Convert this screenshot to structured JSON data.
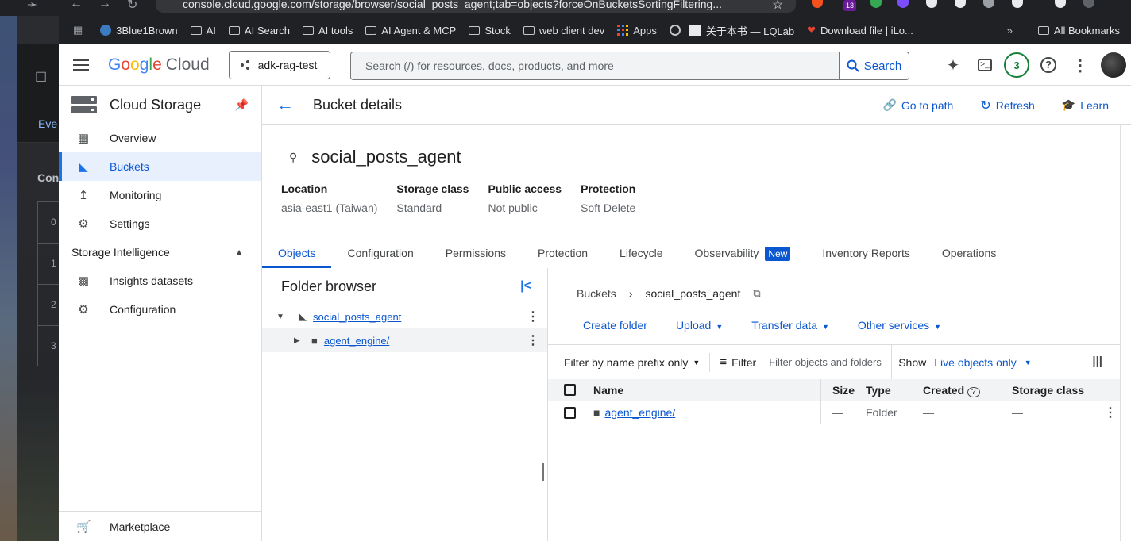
{
  "browser": {
    "url": "console.cloud.google.com/storage/browser/social_posts_agent;tab=objects?forceOnBucketsSortingFiltering...",
    "ext_badge": "13",
    "bookmarks": [
      "3Blue1Brown",
      "AI",
      "AI Search",
      "AI tools",
      "AI Agent & MCP",
      "Stock",
      "web client dev",
      "Apps",
      "关于本书 — LQLab",
      "Download file | iLo..."
    ],
    "more": "»",
    "all_bookmarks": "All Bookmarks"
  },
  "background_window": {
    "eve": "Eve",
    "con": "Con",
    "rows": [
      "0",
      "1",
      "2",
      "3"
    ]
  },
  "header": {
    "logo_google": "Google",
    "logo_cloud": "Cloud",
    "project": "adk-rag-test",
    "search_placeholder": "Search (/) for resources, docs, products, and more",
    "search_button": "Search",
    "notifications_count": "3"
  },
  "leftnav": {
    "title": "Cloud Storage",
    "items": [
      {
        "label": "Overview",
        "icon": "dashboard-icon"
      },
      {
        "label": "Buckets",
        "icon": "bucket-icon",
        "active": true
      },
      {
        "label": "Monitoring",
        "icon": "chart-icon"
      },
      {
        "label": "Settings",
        "icon": "gear-icon"
      }
    ],
    "section": "Storage Intelligence",
    "section_items": [
      {
        "label": "Insights datasets",
        "icon": "dataset-icon"
      },
      {
        "label": "Configuration",
        "icon": "gear-icon"
      }
    ],
    "marketplace": "Marketplace"
  },
  "subheader": {
    "title": "Bucket details",
    "go_to_path": "Go to path",
    "refresh": "Refresh",
    "learn": "Learn"
  },
  "bucket": {
    "name": "social_posts_agent",
    "props": [
      {
        "key": "Location",
        "value": "asia-east1 (Taiwan)"
      },
      {
        "key": "Storage class",
        "value": "Standard"
      },
      {
        "key": "Public access",
        "value": "Not public"
      },
      {
        "key": "Protection",
        "value": "Soft Delete"
      }
    ]
  },
  "tabs": [
    "Objects",
    "Configuration",
    "Permissions",
    "Protection",
    "Lifecycle",
    "Observability",
    "Inventory Reports",
    "Operations"
  ],
  "new_badge": "New",
  "folder_browser": {
    "title": "Folder browser",
    "root": "social_posts_agent",
    "child": "agent_engine/"
  },
  "objects": {
    "crumb_root": "Buckets",
    "crumb_current": "social_posts_agent",
    "actions": [
      "Create folder",
      "Upload",
      "Transfer data",
      "Other services"
    ],
    "filter_prefix": "Filter by name prefix only",
    "filter": "Filter",
    "filter_placeholder": "Filter objects and folders",
    "show": "Show",
    "show_value": "Live objects only",
    "columns": [
      "Name",
      "Size",
      "Type",
      "Created",
      "Storage class"
    ],
    "rows": [
      {
        "name": "agent_engine/",
        "size": "—",
        "type": "Folder",
        "created": "—",
        "storage": "—"
      }
    ]
  }
}
